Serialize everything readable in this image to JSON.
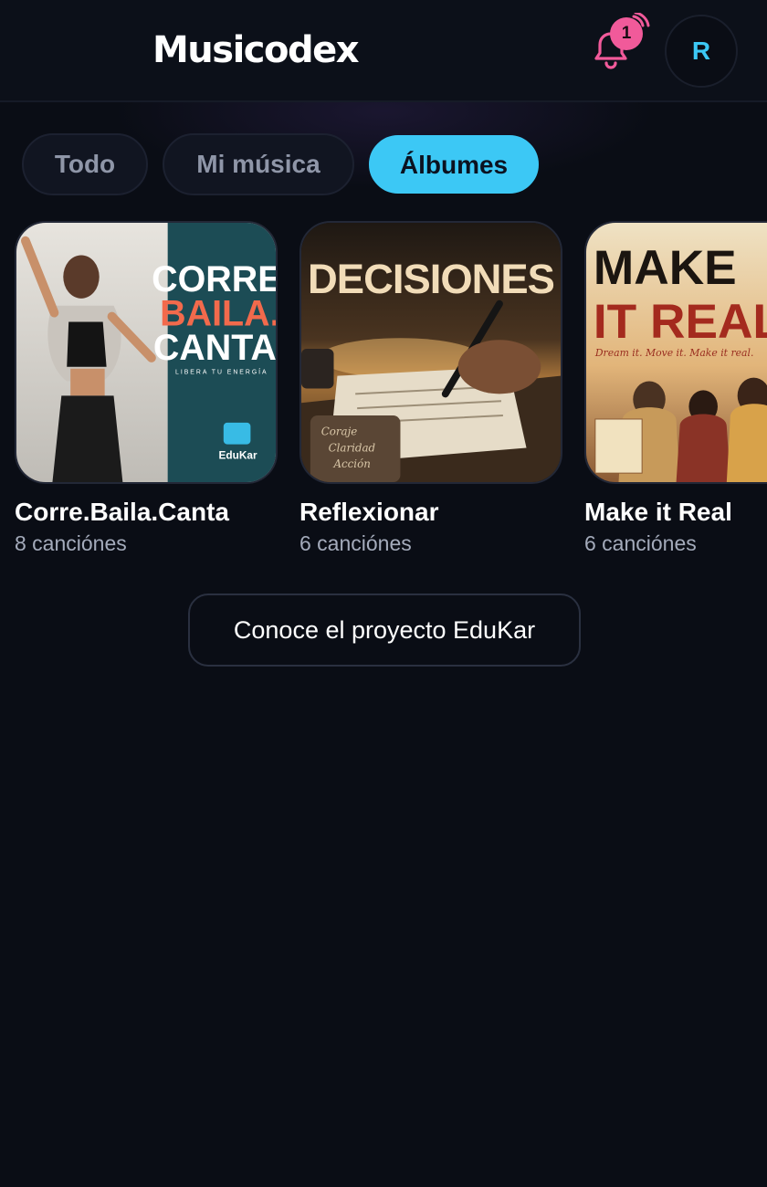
{
  "header": {
    "brand": "Musicodex",
    "notifications_count": "1",
    "avatar_initial": "R"
  },
  "icons": {
    "logo": "sound-wave-logo",
    "notifications": "bell-icon"
  },
  "colors": {
    "background": "#0a0d15",
    "accent": "#3cc8f5",
    "notification": "#f15a9a",
    "muted_text": "#a4abbb"
  },
  "tabs": [
    {
      "label": "Todo",
      "active": false
    },
    {
      "label": "Mi música",
      "active": false
    },
    {
      "label": "Álbumes",
      "active": true
    }
  ],
  "albums": [
    {
      "title": "Corre.Baila.Canta",
      "count": "8 canciónes",
      "cover": {
        "line1": "CORRE.",
        "line2": "BAILA.",
        "line3": "CANTA.",
        "tagline": "LIBERA TU ENERGÍA",
        "label": "EduKar"
      }
    },
    {
      "title": "Reflexionar",
      "count": "6 canciónes",
      "cover": {
        "headline": "DECISIONES",
        "note1": "Coraje",
        "note2": "Claridad",
        "note3": "Acción"
      }
    },
    {
      "title": "Make it Real",
      "count": "6 canciónes",
      "cover": {
        "line1": "MAKE",
        "line2": "IT REAL",
        "tagline": "Dream it. Move it. Make it real."
      }
    }
  ],
  "cta": {
    "label": "Conoce el proyecto EduKar"
  }
}
